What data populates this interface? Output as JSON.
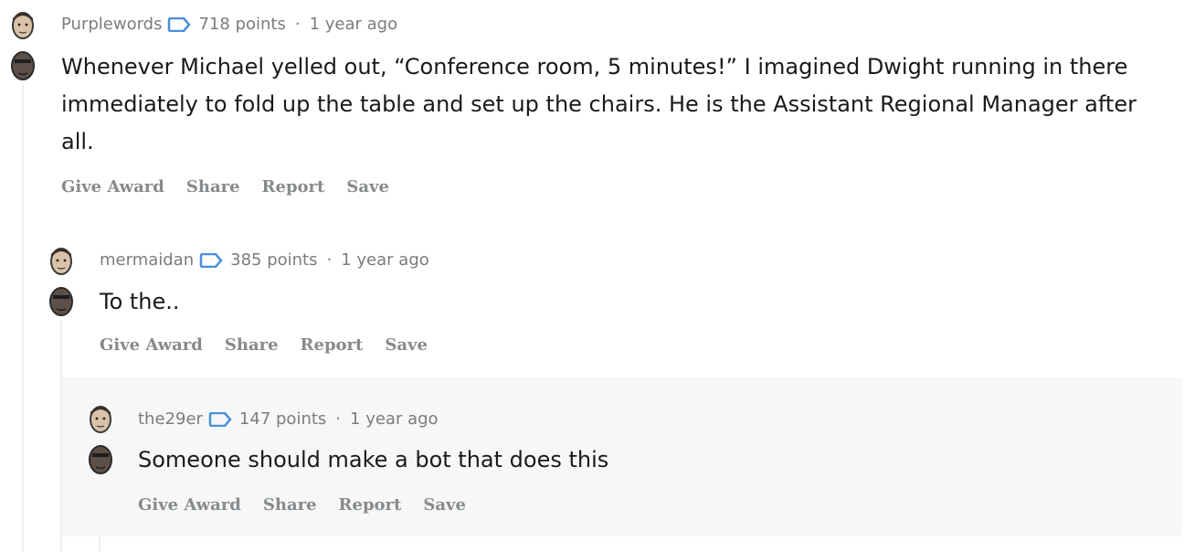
{
  "comments": [
    {
      "username": "Purplewords",
      "points": "718 points",
      "separator": "·",
      "time": "1 year ago",
      "body": "Whenever Michael yelled out, “Conference room, 5 minutes!” I imagined Dwight running in there immediately to fold up the table and set up the chairs. He is the Assistant Regional Manager after all.",
      "actions": [
        "Give Award",
        "Share",
        "Report",
        "Save"
      ]
    },
    {
      "username": "mermaidan",
      "points": "385 points",
      "separator": "·",
      "time": "1 year ago",
      "body": "To the..",
      "actions": [
        "Give Award",
        "Share",
        "Report",
        "Save"
      ]
    },
    {
      "username": "the29er",
      "points": "147 points",
      "separator": "·",
      "time": "1 year ago",
      "body": "Someone should make a bot that does this",
      "actions": [
        "Give Award",
        "Share",
        "Report",
        "Save"
      ]
    }
  ],
  "colors": {
    "flair": "#4a90d9",
    "meta": "#7c7c7c",
    "action": "#878a8c",
    "nested_bg": "#f6f7f8"
  },
  "icons": {
    "flair": "tag-icon",
    "avatar_top": "jim-face-icon",
    "avatar_bottom": "dwight-face-icon"
  }
}
